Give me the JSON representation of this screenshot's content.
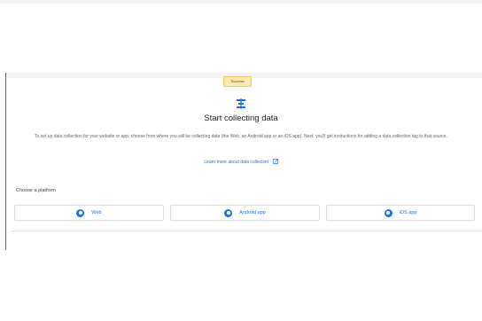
{
  "toast": {
    "text": "Success"
  },
  "hero": {
    "title": "Start collecting data",
    "description": "To set up data collection for your website or app, choose from where you will be collecting data (the Web, an Android app or an iOS app). Next, you'll get instructions for adding a data collection tag to that source.",
    "learn_more": "Learn more about data collection"
  },
  "platforms": {
    "label": "Choose a platform",
    "items": [
      {
        "label": "Web",
        "icon": "web-icon"
      },
      {
        "label": "Android app",
        "icon": "android-icon"
      },
      {
        "label": "iOS app",
        "icon": "ios-icon"
      }
    ]
  },
  "colors": {
    "accent": "#1a73e8",
    "toast_bg": "#fce8b2",
    "border": "#dadce0"
  }
}
